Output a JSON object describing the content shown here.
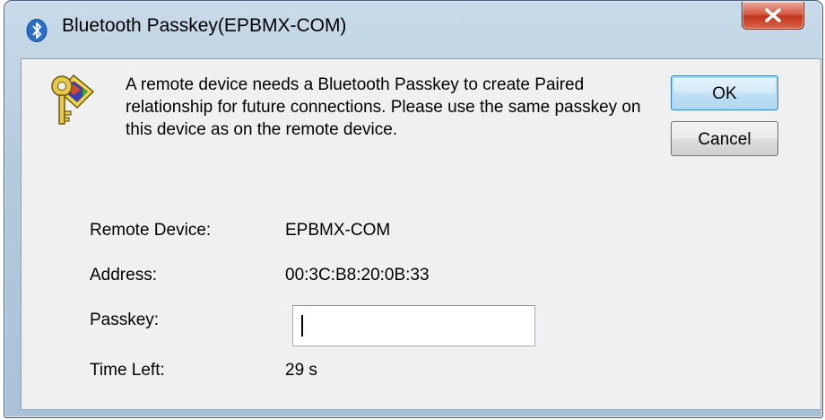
{
  "window": {
    "title": "Bluetooth Passkey(EPBMX-COM)"
  },
  "message": "A remote device needs a Bluetooth Passkey to create Paired relationship for future connections. Please use the same passkey on this device as on the remote device.",
  "buttons": {
    "ok": "OK",
    "cancel": "Cancel"
  },
  "fields": {
    "remote_device": {
      "label": "Remote Device:",
      "value": "EPBMX-COM"
    },
    "address": {
      "label": "Address:",
      "value": "00:3C:B8:20:0B:33"
    },
    "passkey": {
      "label": "Passkey:",
      "value": ""
    },
    "time_left": {
      "label": "Time Left:",
      "value": "29 s"
    }
  },
  "icons": {
    "title": "bluetooth-icon",
    "close": "close-icon",
    "message": "keys-icon"
  },
  "colors": {
    "title_bar": "#b3cadd",
    "close_button": "#c0341c",
    "client_bg": "#f0f0f0",
    "ok_focus": "#3c7fb1"
  }
}
